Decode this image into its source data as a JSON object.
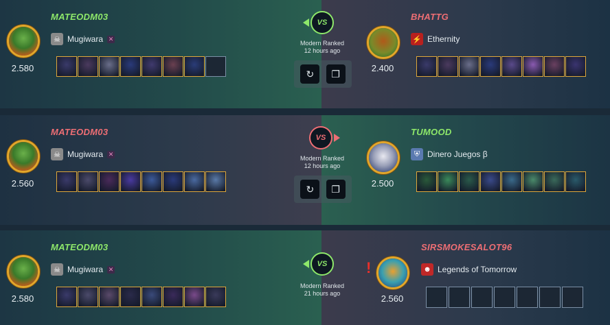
{
  "matches": [
    {
      "left": {
        "name": "MATEODM03",
        "result": "win",
        "rating": "2.580",
        "guild": "Mugiwara",
        "guild_badge": "✕",
        "cards": [
          "#3a3a6a",
          "#4b3a5e",
          "#6a6e8a",
          "#2a3a7a",
          "#403a6e",
          "#6a4050",
          "#2a3c78",
          "empty"
        ]
      },
      "right": {
        "name": "BHATTG",
        "result": "lose",
        "rating": "2.400",
        "guild": "Ethernity",
        "cards": [
          "#3a3a6a",
          "#4b3a5e",
          "#6a6e8a",
          "#2a3a7a",
          "#5a4a8a",
          "#8a5ab0",
          "#6a4060",
          "#3a3470"
        ]
      },
      "vs": "VS",
      "format": "Modern Ranked",
      "time": "12 hours ago",
      "show_actions": true,
      "actions": {
        "replay_icon": "replay-icon",
        "copy_icon": "copy-icon"
      }
    },
    {
      "left": {
        "name": "MATEODM03",
        "result": "lose",
        "rating": "2.560",
        "guild": "Mugiwara",
        "guild_badge": "✕",
        "cards": [
          "#3a3a6a",
          "#4b4a6a",
          "#4a2a5a",
          "#4a3aa0",
          "#3c5a9a",
          "#2a3a7a",
          "#4a6aa0",
          "#5a7aa8"
        ]
      },
      "right": {
        "name": "TUMOOD",
        "result": "win",
        "rating": "2.500",
        "guild": "Dinero Juegos β",
        "cards": [
          "#2a5a3a",
          "#3a8a5a",
          "#2a5a4a",
          "#3a4a8a",
          "#3a6a8a",
          "#4a8a6a",
          "#3a6a5a",
          "#2a5a6a"
        ]
      },
      "vs": "VS",
      "format": "Modern Ranked",
      "time": "12 hours ago",
      "show_actions": true,
      "actions": {
        "replay_icon": "replay-icon",
        "copy_icon": "copy-icon"
      }
    },
    {
      "left": {
        "name": "MATEODM03",
        "result": "win",
        "rating": "2.580",
        "guild": "Mugiwara",
        "guild_badge": "✕",
        "cards": [
          "#3a3a6a",
          "#4b4a6a",
          "#5a4a6a",
          "#2a2a4a",
          "#3a4a7a",
          "#3a2a5a",
          "#7a4a8a",
          "#3a3a5a"
        ]
      },
      "right": {
        "name": "SIRSMOKESALOT96",
        "result": "lose",
        "rating": "2.560",
        "guild": "Legends of Tomorrow",
        "cards": [
          "empty",
          "empty",
          "empty",
          "empty",
          "empty",
          "empty",
          "empty"
        ]
      },
      "vs": "VS",
      "format": "Modern Ranked",
      "time": "21 hours ago",
      "show_actions": false,
      "alert": "!"
    }
  ]
}
